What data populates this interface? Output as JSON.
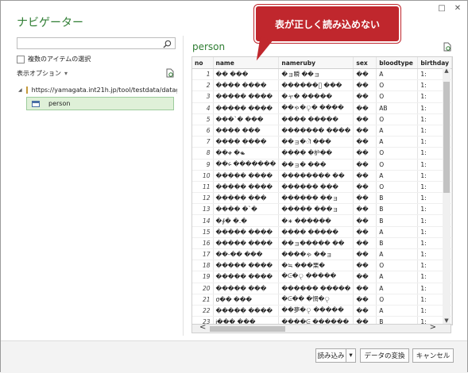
{
  "window": {
    "title": "ナビゲーター",
    "restore_glyph": "□",
    "close_glyph": "✕"
  },
  "left": {
    "search_placeholder": "",
    "checkbox_label": "複数のアイテムの選択",
    "options_label": "表示オプション",
    "options_arrow": "▾",
    "tree": {
      "expand_glyph": "◢",
      "source_url": "https://yamagata.int21h.jp/tool/testdata/datag...",
      "table_name": "person"
    }
  },
  "preview": {
    "title": "person"
  },
  "callout": {
    "text": "表が正しく読み込めない"
  },
  "table": {
    "columns": [
      "no",
      "name",
      "nameruby",
      "sex",
      "bloodtype",
      "birthday"
    ],
    "rows": [
      [
        "1",
        "�� ���",
        "�ョ瞬 ��ョ",
        "��",
        "A",
        "1:"
      ],
      [
        "2",
        "���� ����",
        "������ু ���",
        "��",
        "O",
        "1:"
      ],
      [
        "3",
        "����� ����",
        "�ャ� �����",
        "��",
        "O",
        "1:"
      ],
      [
        "4",
        "����� ����",
        "��ゃ�ৃ� ����",
        "��",
        "AB",
        "1:"
      ],
      [
        "5",
        "���`� ���",
        "���� �����",
        "��",
        "O",
        "1:"
      ],
      [
        "6",
        "���� ���",
        "������� ����",
        "��",
        "A",
        "1:"
      ],
      [
        "7",
        "���� ����",
        "��ョ�ॊ ���",
        "��",
        "A",
        "1:"
      ],
      [
        "8",
        "��ቀ �ቈ",
        "���� �枦��",
        "��",
        "O",
        "1:"
      ],
      [
        "9",
        "��ሩ �������",
        "��ョ� ���",
        "��",
        "O",
        "1:"
      ],
      [
        "10",
        "����� ����",
        "�������� ��",
        "��",
        "A",
        "1:"
      ],
      [
        "11",
        "����� ����",
        "������ ���",
        "��",
        "O",
        "1:"
      ],
      [
        "12",
        "����� ���",
        "������ ��ョ",
        "��",
        "B",
        "1:"
      ],
      [
        "13",
        "���� �`�",
        "����� ���ョ",
        "��",
        "B",
        "1:"
      ],
      [
        "14",
        "�∮� �.�",
        "�∗ ������",
        "��",
        "B",
        "1:"
      ],
      [
        "15",
        "����� ����",
        "���� �����",
        "��",
        "A",
        "1:"
      ],
      [
        "16",
        "����� ����",
        "��ョ����� ��",
        "��",
        "B",
        "1:"
      ],
      [
        "17",
        "��-�� ���",
        "����ゃ ��ョ",
        "��",
        "A",
        "1:"
      ],
      [
        "18",
        "����� ����",
        "�≒ ���栗�",
        "��",
        "O",
        "1:"
      ],
      [
        "19",
        "����� ����",
        "�ᕮ�ৃ �����",
        "��",
        "A",
        "1:"
      ],
      [
        "20",
        "����� ���",
        "������ �����",
        "��",
        "A",
        "1:"
      ],
      [
        "21",
        "σ�� ���",
        "�ᕮ�� �惘�ৃ",
        "��",
        "O",
        "1:"
      ],
      [
        "22",
        "����� ����",
        "��夢�ৃ �����",
        "��",
        "A",
        "1:"
      ],
      [
        "23",
        "Ꭵ��� ���",
        "����ᕮ ������",
        "��",
        "B",
        "1:"
      ]
    ]
  },
  "scroll": {
    "up": "▲",
    "down": "▼",
    "left": "<",
    "right": ">"
  },
  "buttons": {
    "load": "読み込み",
    "load_arrow": "▾",
    "transform": "データの変換",
    "cancel": "キャンセル"
  }
}
